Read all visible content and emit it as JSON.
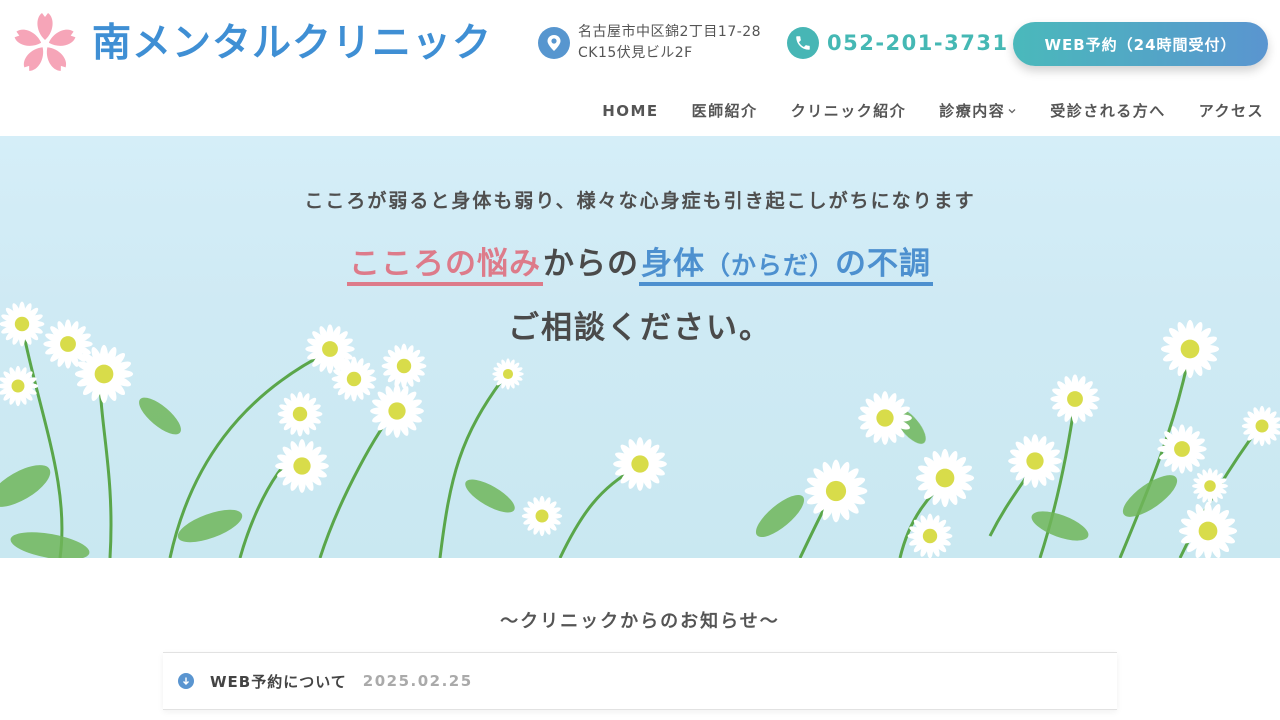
{
  "header": {
    "logo_text": "南メンタルクリニック",
    "address_line1": "名古屋市中区錦2丁目17-28",
    "address_line2": "CK15伏見ビル2F",
    "phone": "052-201-3731",
    "web_booking_label": "WEB予約（24時間受付）"
  },
  "nav": {
    "items": [
      {
        "label": "HOME"
      },
      {
        "label": "医師紹介"
      },
      {
        "label": "クリニック紹介"
      },
      {
        "label": "診療内容"
      },
      {
        "label": "受診される方へ"
      },
      {
        "label": "アクセス"
      }
    ]
  },
  "hero": {
    "subtitle": "こころが弱ると身体も弱り、様々な心身症も引き起こしがちになります",
    "headline_pink": "こころの悩み",
    "headline_mid": "からの",
    "headline_blue_a": "身体",
    "headline_blue_paren": "（からだ）",
    "headline_blue_b": "の不調",
    "headline_line2": "ご相談ください。"
  },
  "news": {
    "section_title": "〜クリニックからのお知らせ〜",
    "items": [
      {
        "title": "WEB予約について",
        "date": "2025.02.25"
      }
    ]
  },
  "colors": {
    "brand_blue": "#3f8fd4",
    "teal": "#45b8b4",
    "pink": "#dd7b8a",
    "accent_blue": "#4d90cf"
  },
  "icons": [
    "sakura-logo-icon",
    "map-pin-icon",
    "phone-icon",
    "chevron-down-icon",
    "arrow-down-circle-icon"
  ]
}
